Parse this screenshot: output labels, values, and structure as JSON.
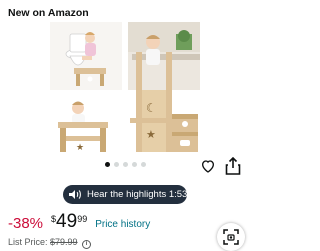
{
  "header": {
    "label": "New on Amazon"
  },
  "gallery": {
    "dot_count": 5,
    "active_index": 0
  },
  "actions": {
    "favorite_icon": "heart-icon",
    "share_icon": "share-icon"
  },
  "audio": {
    "label": "Hear the highlights 1:53"
  },
  "price": {
    "discount": "-38%",
    "currency": "$",
    "whole": "49",
    "fraction": "99",
    "history_link": "Price history"
  },
  "list_price": {
    "label": "List Price:",
    "value": "$79.99",
    "info_icon": "info-icon"
  },
  "visual_search": {
    "icon": "camera-scan-icon"
  },
  "colors": {
    "discount": "#cc0c39",
    "link": "#007185",
    "pill": "#232f3e",
    "wood": "#dcc097"
  }
}
